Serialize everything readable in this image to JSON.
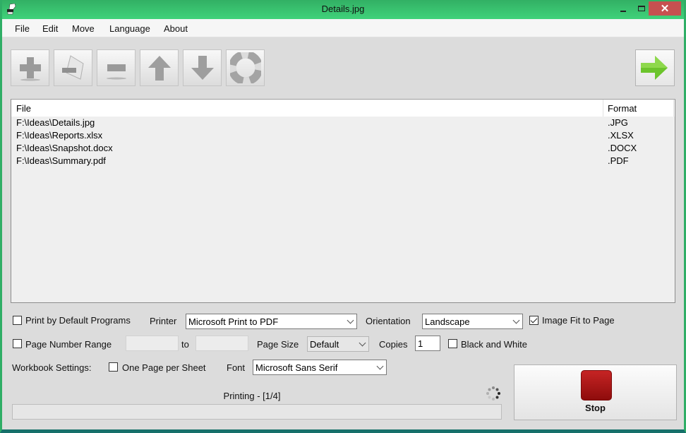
{
  "window": {
    "title": "Details.jpg",
    "controls": {
      "minimize": "minimize",
      "maximize": "maximize",
      "close": "close"
    }
  },
  "menu": [
    "File",
    "Edit",
    "Move",
    "Language",
    "About"
  ],
  "toolbar": {
    "buttons": [
      {
        "name": "add",
        "icon": "plus-icon"
      },
      {
        "name": "remove-file",
        "icon": "remove-document-icon"
      },
      {
        "name": "remove",
        "icon": "minus-icon"
      },
      {
        "name": "move-up",
        "icon": "arrow-up-icon"
      },
      {
        "name": "move-down",
        "icon": "arrow-down-icon"
      },
      {
        "name": "help",
        "icon": "lifebuoy-icon"
      }
    ],
    "start": {
      "icon": "arrow-right-icon"
    }
  },
  "file_list": {
    "columns": [
      "File",
      "Format"
    ],
    "rows": [
      {
        "file": "F:\\Ideas\\Details.jpg",
        "format": ".JPG"
      },
      {
        "file": "F:\\Ideas\\Reports.xlsx",
        "format": ".XLSX"
      },
      {
        "file": "F:\\Ideas\\Snapshot.docx",
        "format": ".DOCX"
      },
      {
        "file": "F:\\Ideas\\Summary.pdf",
        "format": ".PDF"
      }
    ]
  },
  "options": {
    "print_by_default": {
      "label": "Print by Default Programs",
      "checked": false
    },
    "printer": {
      "label": "Printer",
      "value": "Microsoft Print to PDF"
    },
    "orientation": {
      "label": "Orientation",
      "value": "Landscape"
    },
    "image_fit": {
      "label": "Image Fit to Page",
      "checked": true
    },
    "page_range": {
      "label": "Page Number Range",
      "checked": false,
      "from": "",
      "to_label": "to",
      "to": ""
    },
    "page_size": {
      "label": "Page Size",
      "value": "Default"
    },
    "copies": {
      "label": "Copies",
      "value": "1"
    },
    "black_white": {
      "label": "Black and White",
      "checked": false
    },
    "workbook_label": "Workbook Settings:",
    "one_page_per_sheet": {
      "label": "One Page per Sheet",
      "checked": false
    },
    "font": {
      "label": "Font",
      "value": "Microsoft Sans Serif"
    }
  },
  "status": {
    "text": "Printing - [1/4]",
    "progress_percent": 0
  },
  "stop_button": {
    "label": "Stop"
  }
}
